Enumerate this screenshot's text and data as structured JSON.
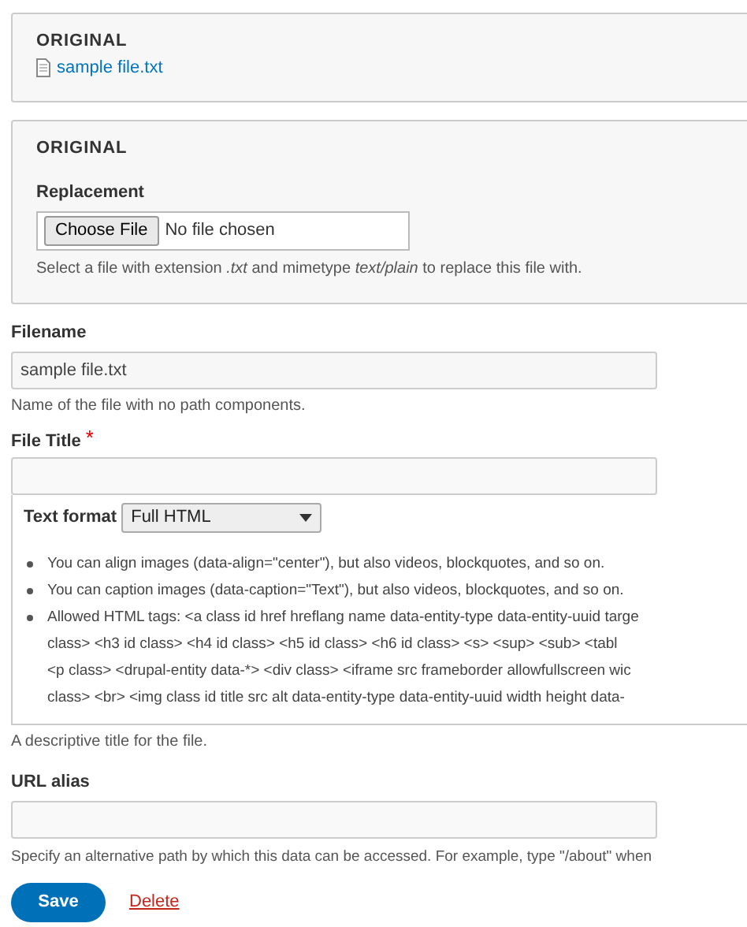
{
  "sections": [
    {
      "title": "ORIGINAL",
      "file_link": "sample file.txt"
    },
    {
      "title": "ORIGINAL",
      "field": {
        "label": "Replacement",
        "button": "Choose File",
        "status": "No file chosen",
        "help": "Select a file with extension *.txt* and mimetype *text/plain* to replace this file with."
      }
    }
  ],
  "filename": {
    "label": "Filename",
    "value": "sample file.txt",
    "help": "Name of the file with no path components."
  },
  "file_title": {
    "label": "File Title",
    "required_mark": "*",
    "text_format": {
      "label": "Text format",
      "selected_option": "Full HTML",
      "tips": [
        {
          "lines": [
            "You can align images (data-align=\"center\"), but also videos, blockquotes, and so on."
          ]
        },
        {
          "lines": [
            "You can caption images (data-caption=\"Text\"), but also videos, blockquotes, and so on."
          ]
        },
        {
          "lines": [
            "Allowed HTML tags: <a class id href hreflang name data-entity-type data-entity-uuid targe",
            "class> <h3 id class> <h4 id class> <h5 id class> <h6 id class> <s> <sup> <sub> <tabl",
            "<p class> <drupal-entity data-*> <div class> <iframe src frameborder allowfullscreen wic",
            "class> <br> <img class id title src alt data-entity-type data-entity-uuid width height data-"
          ]
        }
      ]
    },
    "help": "A descriptive title for the file."
  },
  "url_alias": {
    "label": "URL alias",
    "help": "Specify an alternative path by which this data can be accessed. For example, type \"/about\" when"
  },
  "actions": [
    {
      "kind": "primary",
      "label": "Save"
    },
    {
      "kind": "link",
      "label": "Delete"
    }
  ]
}
